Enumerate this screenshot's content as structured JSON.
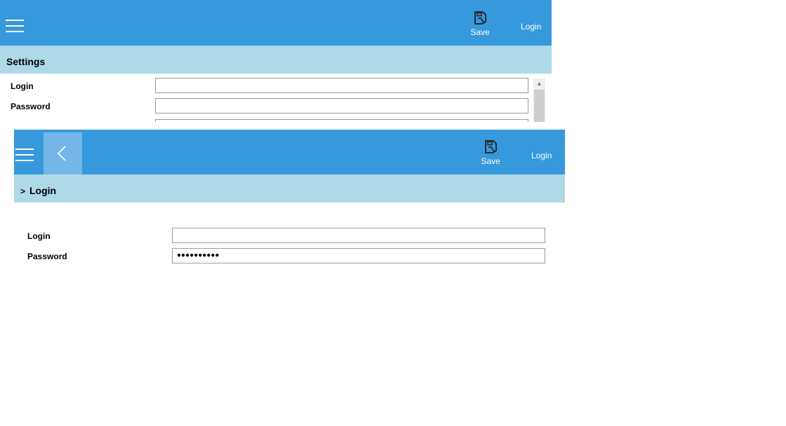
{
  "colors": {
    "topbar": "#3699dc",
    "subbar": "#aed9e6",
    "back_button": "#75b6e8",
    "label_text": "#000000",
    "header_text": "#ffffff"
  },
  "window1": {
    "menu_icon": "hamburger-icon",
    "save_icon": "floppy-disk-icon",
    "save_label": "Save",
    "login_link": "Login",
    "page_title": "Settings",
    "fields": {
      "login_label": "Login",
      "password_label": "Password",
      "login_value": "",
      "password_value": ""
    }
  },
  "window2": {
    "menu_icon": "hamburger-icon",
    "back_icon": "chevron-left-icon",
    "save_icon": "floppy-disk-icon",
    "save_label": "Save",
    "login_link": "Login",
    "breadcrumb_separator": ">",
    "page_title": "Login",
    "fields": {
      "login_label": "Login",
      "password_label": "Password",
      "login_value": "",
      "password_value": "●●●●●●●●●●"
    }
  }
}
